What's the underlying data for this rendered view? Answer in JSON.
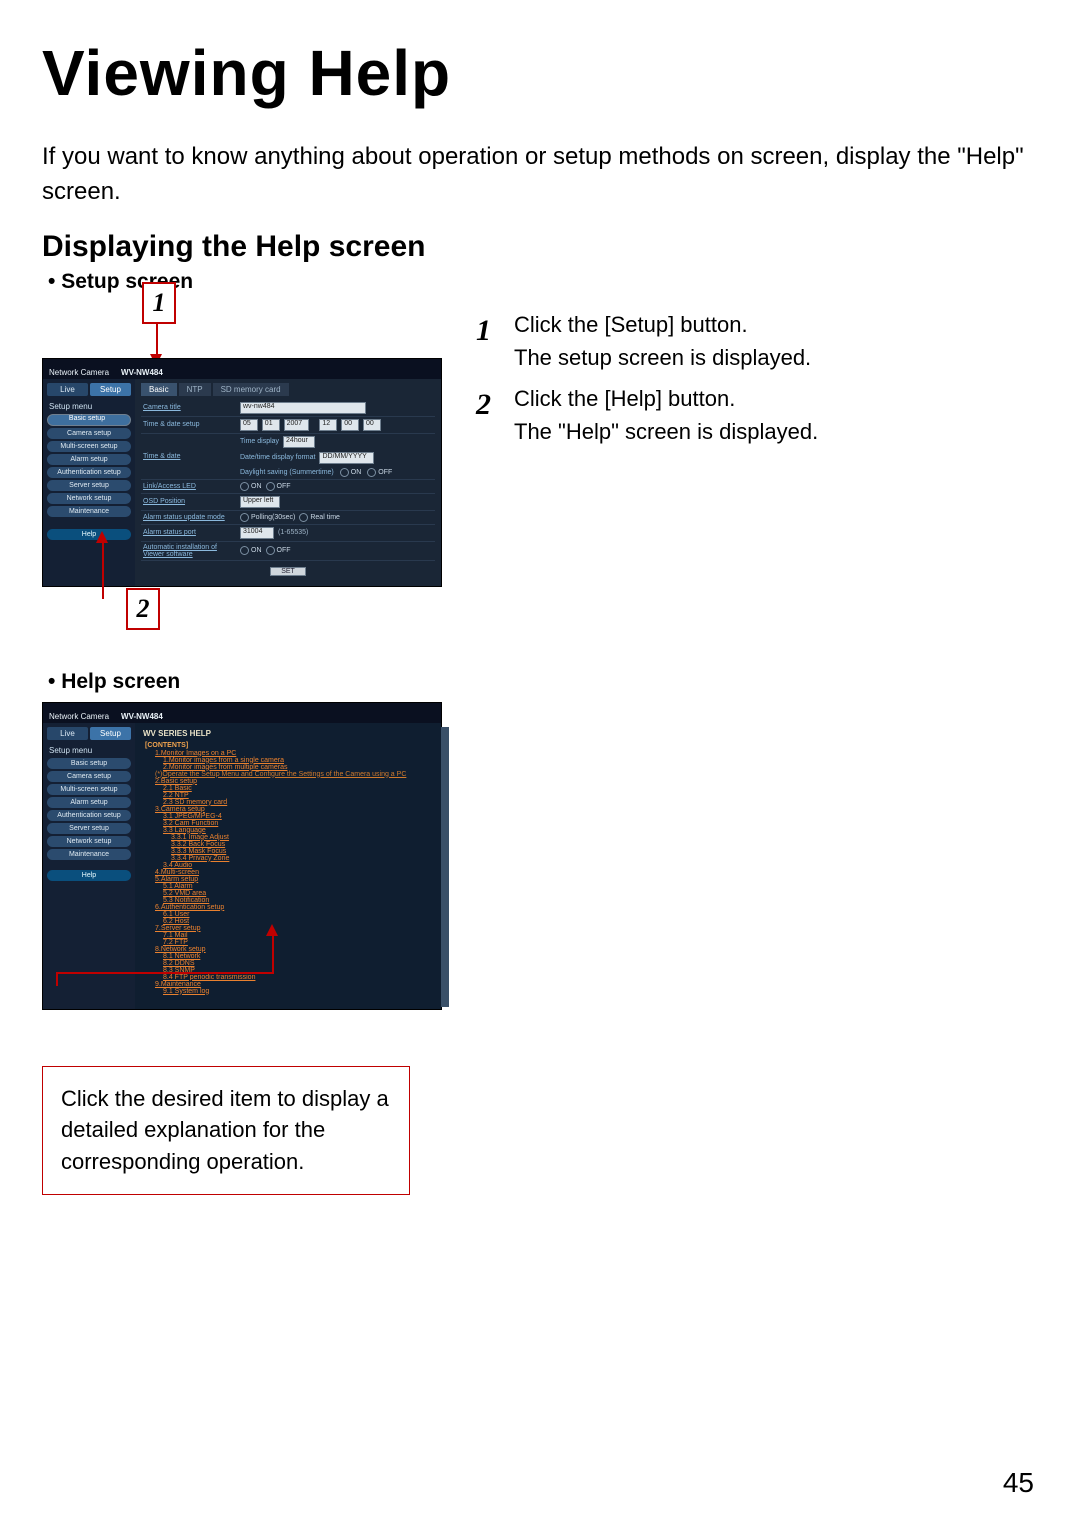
{
  "page_title": "Viewing Help",
  "intro": "If you want to know anything about operation or setup methods on screen, display the \"Help\" screen.",
  "section_title": "Displaying the Help screen",
  "setup_heading": "Setup screen",
  "help_heading": "Help screen",
  "page_number": "45",
  "callouts": {
    "one": "1",
    "two": "2"
  },
  "steps": {
    "s1_num": "1",
    "s1_line1": "Click the [Setup] button.",
    "s1_line2": "The setup screen is displayed.",
    "s2_num": "2",
    "s2_line1": "Click the [Help] button.",
    "s2_line2": "The \"Help\" screen is displayed."
  },
  "note_text": "Click the desired item to display a detailed explanation for the corresponding operation.",
  "app": {
    "brand_line": "Network Camera",
    "model": "WV-NW484",
    "tabs": {
      "live": "Live",
      "setup": "Setup"
    },
    "side_title": "Setup menu",
    "menu": {
      "basic": "Basic setup",
      "camera": "Camera setup",
      "multi": "Multi-screen setup",
      "alarm": "Alarm setup",
      "auth": "Authentication setup",
      "server": "Server setup",
      "network": "Network setup",
      "maint": "Maintenance",
      "help": "Help"
    },
    "main_tabs": {
      "basic": "Basic",
      "ntp": "NTP",
      "sd": "SD memory card"
    },
    "form": {
      "camera_title_lab": "Camera title",
      "camera_title_val": "wv-nw484",
      "time_date_lab": "Time & date",
      "time_date_row_label": "Time & date setup",
      "time_display_lab": "Time display",
      "time_display_val": "24hour",
      "datefmt_lab": "Date/time display format",
      "datefmt_val": "DD/MM/YYYY",
      "dst_lab": "Daylight saving (Summertime)",
      "on": "ON",
      "off": "OFF",
      "link_led_lab": "Link/Access LED",
      "osd_pos_lab": "OSD Position",
      "osd_pos_val": "Upper left",
      "alarm_notice_lab": "Alarm status update mode",
      "poll": "Polling(30sec)",
      "realtime": "Real time",
      "alarm_port_lab": "Alarm status port",
      "alarm_port_val": "31004",
      "alarm_port_note": "(1-65535)",
      "auto_install_lab": "Automatic installation of Viewer software",
      "set_btn": "SET"
    },
    "help_title": "WV SERIES HELP",
    "help_contents_head": "[CONTENTS]",
    "help_items": {
      "h1": "1.Monitor Images on a PC",
      "h1a": "1.Monitor images from a single camera",
      "h1b": "2.Monitor images from multiple cameras",
      "note": "(*)Operate the Setup Menu and Configure the Settings of the Camera using a PC",
      "h2": "2.Basic setup",
      "h2a": "2.1 Basic",
      "h2b": "2.2 NTP",
      "h2c": "2.3 SD memory card",
      "h3": "3.Camera setup",
      "h3a": "3.1 JPEG/MPEG-4",
      "h3b": "3.2 Cam Function",
      "h3c": "3.3 Language",
      "h3c1": "3.3.1 Image Adjust",
      "h3c2": "3.3.2 Back Focus",
      "h3c3": "3.3.3 Mask Focus",
      "h3c4": "3.3.4 Privacy Zone",
      "h3d": "3.4 Audio",
      "h4": "4.Multi-screen",
      "h5": "5.Alarm setup",
      "h5a": "5.1 Alarm",
      "h5b": "5.2 VMD area",
      "h5c": "5.3 Notification",
      "h6": "6.Authentication setup",
      "h6a": "6.1 User",
      "h6b": "6.2 Host",
      "h7": "7.Server setup",
      "h7a": "7.1 Mail",
      "h7b": "7.2 FTP",
      "h8": "8.Network setup",
      "h8a": "8.1 Network",
      "h8b": "8.2 DDNS",
      "h8c": "8.3 SNMP",
      "h8d": "8.4 FTP periodic transmission",
      "h9": "9.Maintenance",
      "h9a": "9.1 System log"
    }
  }
}
